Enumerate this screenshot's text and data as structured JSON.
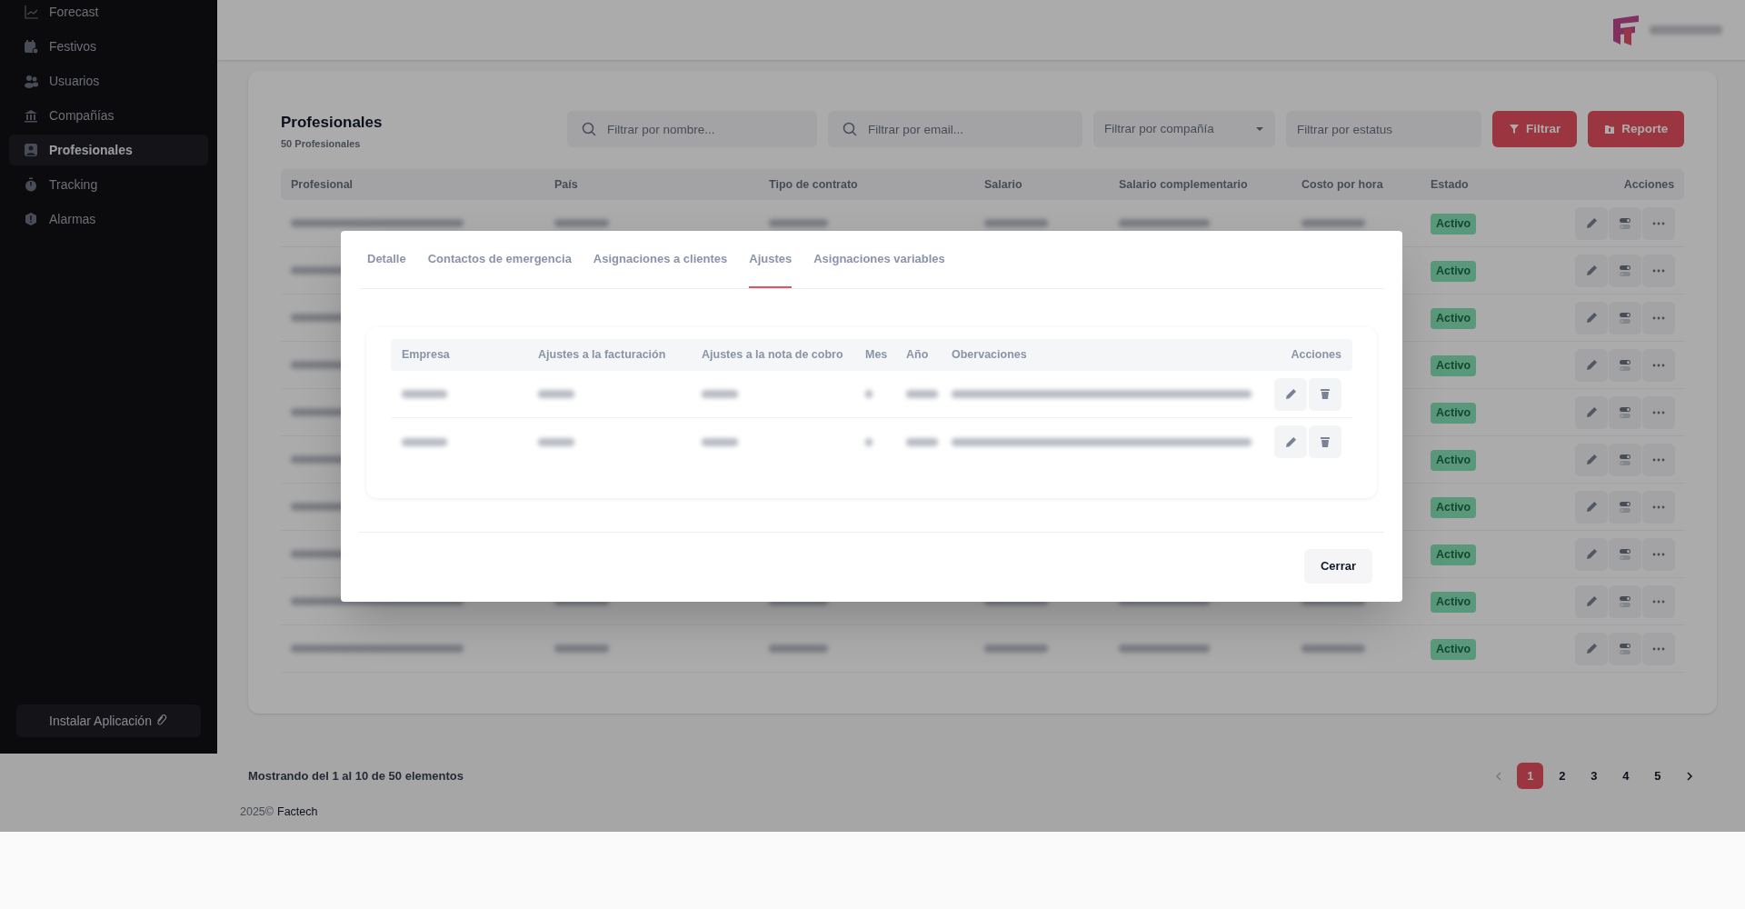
{
  "sidebar": {
    "items": [
      {
        "label": "Forecast",
        "kind": "chart",
        "selected": false
      },
      {
        "label": "Festivos",
        "kind": "calendar",
        "selected": false
      },
      {
        "label": "Usuarios",
        "kind": "users",
        "selected": false
      },
      {
        "label": "Compañías",
        "kind": "bank",
        "selected": false
      },
      {
        "label": "Profesionales",
        "kind": "person",
        "selected": true
      },
      {
        "label": "Tracking",
        "kind": "stopwatch",
        "selected": false
      },
      {
        "label": "Alarmas",
        "kind": "alert",
        "selected": false
      }
    ],
    "install_button": "Instalar Aplicación"
  },
  "page": {
    "title": "Profesionales",
    "subtitle": "50 Profesionales",
    "filters": [
      {
        "kind": "search",
        "placeholder": "Filtrar por nombre..."
      },
      {
        "kind": "search",
        "placeholder": "Filtrar por email..."
      },
      {
        "kind": "select",
        "placeholder": "Filtrar por compañía"
      },
      {
        "kind": "text",
        "placeholder": "Filtrar por estatus"
      }
    ],
    "buttons": [
      {
        "label": "Filtrar",
        "kind": "filter"
      },
      {
        "label": "Reporte",
        "kind": "report"
      }
    ]
  },
  "table": {
    "columns": [
      "Profesional",
      "País",
      "Tipo de contrato",
      "Salario",
      "Salario complementario",
      "Costo por hora",
      "Estado",
      "Acciones"
    ],
    "rows": [
      {
        "kind": "redacted",
        "status": "Activo"
      },
      {
        "kind": "redacted",
        "status": "Activo"
      },
      {
        "kind": "redacted",
        "status": "Activo"
      },
      {
        "kind": "redacted",
        "status": "Activo"
      },
      {
        "kind": "redacted",
        "status": "Activo"
      },
      {
        "kind": "redacted",
        "status": "Activo"
      },
      {
        "kind": "redacted",
        "status": "Activo"
      },
      {
        "kind": "redacted",
        "status": "Activo"
      },
      {
        "kind": "redacted",
        "status": "Activo"
      },
      {
        "kind": "redacted",
        "status": "Activo"
      }
    ]
  },
  "pagination": {
    "summary": "Mostrando del 1 al 10 de 50 elementos",
    "pages": [
      {
        "label": "1",
        "selected": true
      },
      {
        "label": "2",
        "selected": false
      },
      {
        "label": "3",
        "selected": false
      },
      {
        "label": "4",
        "selected": false
      },
      {
        "label": "5",
        "selected": false
      }
    ]
  },
  "footer": {
    "year": "2025©",
    "brand": "Factech"
  },
  "modal": {
    "tabs": [
      {
        "label": "Detalle",
        "selected": false
      },
      {
        "label": "Contactos de emergencia",
        "selected": false
      },
      {
        "label": "Asignaciones a clientes",
        "selected": false
      },
      {
        "label": "Ajustes",
        "selected": true
      },
      {
        "label": "Asignaciones variables",
        "selected": false
      }
    ],
    "table": {
      "columns": [
        "Empresa",
        "Ajustes a la facturación",
        "Ajustes a la nota de cobro",
        "Mes",
        "Año",
        "Obervaciones",
        "Acciones"
      ],
      "rows": [
        {
          "kind": "redacted"
        },
        {
          "kind": "redacted"
        }
      ]
    },
    "close_button": "Cerrar"
  }
}
